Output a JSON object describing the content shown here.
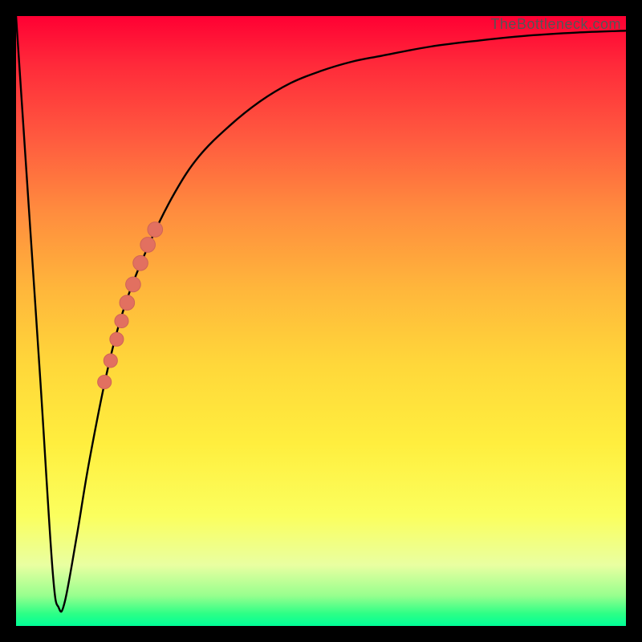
{
  "watermark": "TheBottleneck.com",
  "colors": {
    "gradient_top_red": "#ff0033",
    "gradient_mid_orange": "#ff8c3e",
    "gradient_mid_yellow": "#ffd73a",
    "gradient_lower_yellowgreen": "#e9ffa1",
    "gradient_bottom_green": "#00ff97",
    "curve_stroke": "#000000",
    "marker_fill": "#e27060",
    "marker_outline": "#cf6457",
    "frame_background": "#000000"
  },
  "chart_data": {
    "type": "line",
    "title": "",
    "xlabel": "",
    "ylabel": "",
    "xlim": [
      0,
      100
    ],
    "ylim": [
      0,
      100
    ],
    "grid": false,
    "legend": false,
    "notes": "No axis ticks or numeric labels are drawn. The color gradient encodes a score: red (top/high y) = bad, green (bottom/low y) = good. The black curve drops from (0,100) to a near-zero minimum around x≈7 then climbs asymptotically toward y≈100. A cluster of salmon markers sits on the rising limb.",
    "series": [
      {
        "name": "bottleneck-curve",
        "x": [
          0,
          2,
          4,
          6,
          7,
          8,
          10,
          12,
          15,
          18,
          22,
          26,
          30,
          35,
          40,
          45,
          50,
          55,
          60,
          68,
          76,
          84,
          92,
          100
        ],
        "y": [
          100,
          70,
          40,
          9,
          3,
          4,
          15,
          27,
          42,
          53,
          63,
          71,
          77,
          82,
          86,
          89,
          91,
          92.5,
          93.5,
          95,
          96,
          96.8,
          97.3,
          97.6
        ]
      }
    ],
    "markers": {
      "name": "highlighted-points",
      "color": "#e27060",
      "points": [
        {
          "x": 14.5,
          "y": 40,
          "r": 1.2
        },
        {
          "x": 15.5,
          "y": 43.5,
          "r": 1.2
        },
        {
          "x": 16.5,
          "y": 47,
          "r": 1.2
        },
        {
          "x": 17.3,
          "y": 50,
          "r": 1.2
        },
        {
          "x": 18.2,
          "y": 53,
          "r": 1.4
        },
        {
          "x": 19.2,
          "y": 56,
          "r": 1.4
        },
        {
          "x": 20.4,
          "y": 59.5,
          "r": 1.4
        },
        {
          "x": 21.6,
          "y": 62.5,
          "r": 1.4
        },
        {
          "x": 22.8,
          "y": 65,
          "r": 1.4
        }
      ]
    }
  }
}
